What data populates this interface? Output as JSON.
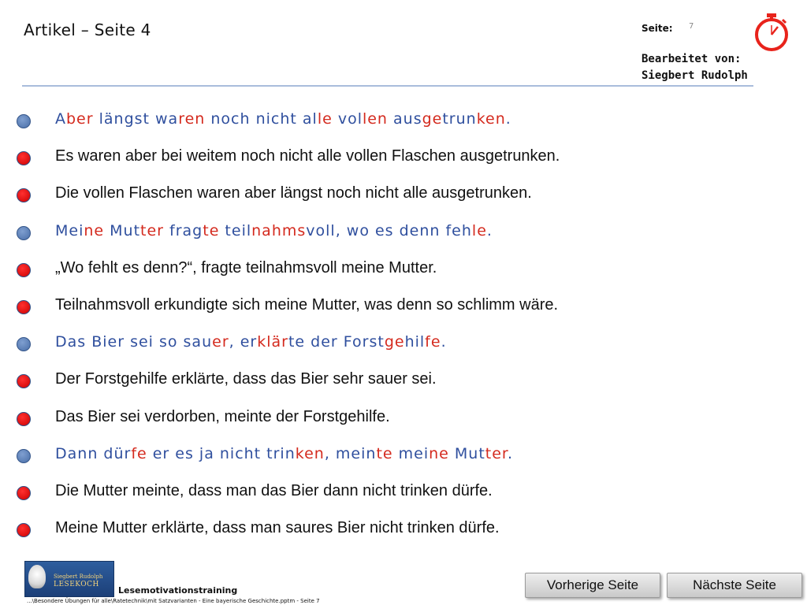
{
  "header": {
    "title": "Artikel – Seite 4",
    "page_label": "Seite:",
    "page_number": "7",
    "editor_label": "Bearbeitet von:",
    "editor_name": "Siegbert Rudolph"
  },
  "colors": {
    "syllable_blue": "#2f4f9e",
    "syllable_red": "#d42a1e",
    "dot_blue": "#4a6fa8",
    "dot_red": "#cc0000",
    "divider": "#a9bddc"
  },
  "icons": {
    "stopwatch": "stopwatch-icon"
  },
  "sentences": [
    {
      "dot": "blue",
      "style": "syllable",
      "segments": [
        {
          "t": "A",
          "c": "b"
        },
        {
          "t": "ber",
          "c": "r"
        },
        {
          "t": " längst ",
          "c": "b"
        },
        {
          "t": "wa",
          "c": "b"
        },
        {
          "t": "ren",
          "c": "r"
        },
        {
          "t": " noch nicht ",
          "c": "b"
        },
        {
          "t": "al",
          "c": "b"
        },
        {
          "t": "le",
          "c": "r"
        },
        {
          "t": " vol",
          "c": "b"
        },
        {
          "t": "len",
          "c": "r"
        },
        {
          "t": " aus",
          "c": "b"
        },
        {
          "t": "ge",
          "c": "r"
        },
        {
          "t": "trun",
          "c": "b"
        },
        {
          "t": "ken",
          "c": "r"
        },
        {
          "t": ".",
          "c": "b"
        }
      ]
    },
    {
      "dot": "red",
      "style": "plain",
      "text": "Es waren aber bei weitem noch nicht alle vollen Flaschen ausgetrunken."
    },
    {
      "dot": "red",
      "style": "plain",
      "text": "Die vollen Flaschen waren aber längst noch nicht alle ausgetrunken."
    },
    {
      "dot": "blue",
      "style": "syllable",
      "segments": [
        {
          "t": "Mei",
          "c": "b"
        },
        {
          "t": "ne",
          "c": "r"
        },
        {
          "t": " Mut",
          "c": "b"
        },
        {
          "t": "ter",
          "c": "r"
        },
        {
          "t": " frag",
          "c": "b"
        },
        {
          "t": "te",
          "c": "r"
        },
        {
          "t": " teil",
          "c": "b"
        },
        {
          "t": "nahms",
          "c": "r"
        },
        {
          "t": "voll, wo es denn feh",
          "c": "b"
        },
        {
          "t": "le",
          "c": "r"
        },
        {
          "t": ".",
          "c": "b"
        }
      ]
    },
    {
      "dot": "red",
      "style": "plain",
      "text": "„Wo fehlt es denn?“, fragte teilnahmsvoll meine Mutter."
    },
    {
      "dot": "red",
      "style": "plain",
      "text": "Teilnahmsvoll erkundigte sich meine Mutter, was denn so schlimm wäre."
    },
    {
      "dot": "blue",
      "style": "syllable",
      "segments": [
        {
          "t": "Das Bier sei so sau",
          "c": "b"
        },
        {
          "t": "er",
          "c": "r"
        },
        {
          "t": ", er",
          "c": "b"
        },
        {
          "t": "klär",
          "c": "r"
        },
        {
          "t": "te der Forst",
          "c": "b"
        },
        {
          "t": "ge",
          "c": "r"
        },
        {
          "t": "hil",
          "c": "b"
        },
        {
          "t": "fe",
          "c": "r"
        },
        {
          "t": ".",
          "c": "b"
        }
      ]
    },
    {
      "dot": "red",
      "style": "plain",
      "text": "Der Forstgehilfe erklärte, dass das Bier sehr sauer sei."
    },
    {
      "dot": "red",
      "style": "plain",
      "text": "Das Bier sei verdorben, meinte der Forstgehilfe."
    },
    {
      "dot": "blue",
      "style": "syllable",
      "segments": [
        {
          "t": "Dann dür",
          "c": "b"
        },
        {
          "t": "fe",
          "c": "r"
        },
        {
          "t": " er es ja nicht trin",
          "c": "b"
        },
        {
          "t": "ken",
          "c": "r"
        },
        {
          "t": ", mein",
          "c": "b"
        },
        {
          "t": "te",
          "c": "r"
        },
        {
          "t": " mei",
          "c": "b"
        },
        {
          "t": "ne",
          "c": "r"
        },
        {
          "t": " Mut",
          "c": "b"
        },
        {
          "t": "ter",
          "c": "r"
        },
        {
          "t": ".",
          "c": "b"
        }
      ]
    },
    {
      "dot": "red",
      "style": "plain",
      "text": "Die Mutter meinte, dass man das Bier dann nicht trinken dürfe."
    },
    {
      "dot": "red",
      "style": "plain",
      "text": "Meine Mutter erklärte, dass man saures Bier nicht trinken dürfe."
    }
  ],
  "footer": {
    "logo_line1": "Siegbert Rudolph",
    "logo_line2": "LESEKOCH",
    "brand": "Lesemotivationstraining",
    "file_path": "...\\Besondere Übungen für alle\\Ratetechnik\\mit Satzvarianten - Eine bayerische Geschichte.pptm - Seite 7",
    "prev_button": "Vorherige Seite",
    "next_button": "Nächste Seite"
  }
}
